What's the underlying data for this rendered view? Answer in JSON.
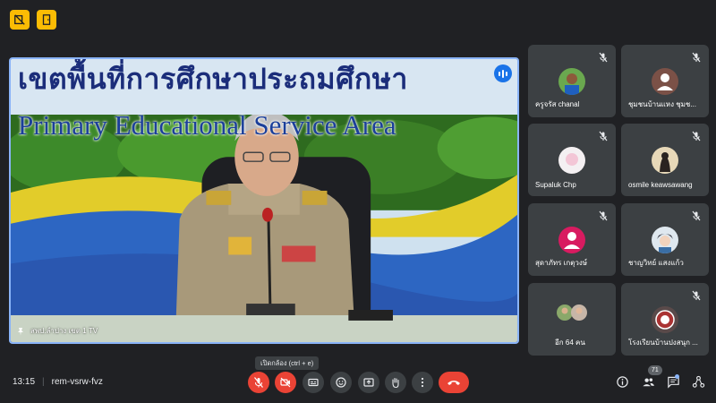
{
  "speaker": {
    "banner_thai": "เขตพื้นที่การศึกษาประถมศึกษา",
    "banner_english": "Primary Educational Service Area",
    "name": "สพป.ลำปาง เขต 1 TV"
  },
  "participants": [
    {
      "name": "ครูจรัส chanal",
      "avatar": "photo-boy"
    },
    {
      "name": "ชุมชนบ้านแหง ชุมช...",
      "avatar": "default-person"
    },
    {
      "name": "Supaluk Chp",
      "avatar": "photo-light"
    },
    {
      "name": "osmile keawsawang",
      "avatar": "photo-cat"
    },
    {
      "name": "สุดาภัทร เกตุวงษ์",
      "avatar": "letter-pink"
    },
    {
      "name": "ชาญวิทย์ แสงแก้ว",
      "avatar": "photo-anime"
    },
    {
      "name": "อีก 64 คน",
      "avatar": "group-pair"
    },
    {
      "name": "โรงเรียนบ้านปงสนุก ...",
      "avatar": "photo-school"
    }
  ],
  "meeting": {
    "time": "13:15",
    "code": "rem-vsrw-fvz",
    "people_count": "71",
    "tooltip": "เปิดกล้อง (ctrl + e)"
  },
  "colors": {
    "background": "#202124",
    "tile": "#3c4043",
    "danger": "#ea4335",
    "accent": "#8ab4f8",
    "top_buttons": "#fbbc04"
  }
}
